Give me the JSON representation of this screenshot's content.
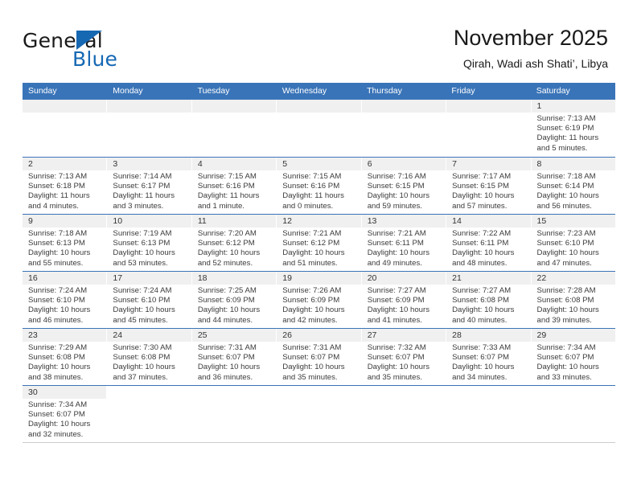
{
  "brand": {
    "name_part1": "General",
    "name_part2": "Blue",
    "logo_icon": "flag-triangle-icon"
  },
  "header": {
    "title": "November 2025",
    "subtitle": "Qirah, Wadi ash Shati’, Libya"
  },
  "calendar": {
    "weekday_headers": [
      "Sunday",
      "Monday",
      "Tuesday",
      "Wednesday",
      "Thursday",
      "Friday",
      "Saturday"
    ],
    "accent_color": "#3a74b8",
    "daynum_strip_color": "#f0f0f0",
    "weeks": [
      [
        {
          "day": "",
          "sunrise": "",
          "sunset": "",
          "daylight_line1": "",
          "daylight_line2": ""
        },
        {
          "day": "",
          "sunrise": "",
          "sunset": "",
          "daylight_line1": "",
          "daylight_line2": ""
        },
        {
          "day": "",
          "sunrise": "",
          "sunset": "",
          "daylight_line1": "",
          "daylight_line2": ""
        },
        {
          "day": "",
          "sunrise": "",
          "sunset": "",
          "daylight_line1": "",
          "daylight_line2": ""
        },
        {
          "day": "",
          "sunrise": "",
          "sunset": "",
          "daylight_line1": "",
          "daylight_line2": ""
        },
        {
          "day": "",
          "sunrise": "",
          "sunset": "",
          "daylight_line1": "",
          "daylight_line2": ""
        },
        {
          "day": "1",
          "sunrise": "Sunrise: 7:13 AM",
          "sunset": "Sunset: 6:19 PM",
          "daylight_line1": "Daylight: 11 hours",
          "daylight_line2": "and 5 minutes."
        }
      ],
      [
        {
          "day": "2",
          "sunrise": "Sunrise: 7:13 AM",
          "sunset": "Sunset: 6:18 PM",
          "daylight_line1": "Daylight: 11 hours",
          "daylight_line2": "and 4 minutes."
        },
        {
          "day": "3",
          "sunrise": "Sunrise: 7:14 AM",
          "sunset": "Sunset: 6:17 PM",
          "daylight_line1": "Daylight: 11 hours",
          "daylight_line2": "and 3 minutes."
        },
        {
          "day": "4",
          "sunrise": "Sunrise: 7:15 AM",
          "sunset": "Sunset: 6:16 PM",
          "daylight_line1": "Daylight: 11 hours",
          "daylight_line2": "and 1 minute."
        },
        {
          "day": "5",
          "sunrise": "Sunrise: 7:15 AM",
          "sunset": "Sunset: 6:16 PM",
          "daylight_line1": "Daylight: 11 hours",
          "daylight_line2": "and 0 minutes."
        },
        {
          "day": "6",
          "sunrise": "Sunrise: 7:16 AM",
          "sunset": "Sunset: 6:15 PM",
          "daylight_line1": "Daylight: 10 hours",
          "daylight_line2": "and 59 minutes."
        },
        {
          "day": "7",
          "sunrise": "Sunrise: 7:17 AM",
          "sunset": "Sunset: 6:15 PM",
          "daylight_line1": "Daylight: 10 hours",
          "daylight_line2": "and 57 minutes."
        },
        {
          "day": "8",
          "sunrise": "Sunrise: 7:18 AM",
          "sunset": "Sunset: 6:14 PM",
          "daylight_line1": "Daylight: 10 hours",
          "daylight_line2": "and 56 minutes."
        }
      ],
      [
        {
          "day": "9",
          "sunrise": "Sunrise: 7:18 AM",
          "sunset": "Sunset: 6:13 PM",
          "daylight_line1": "Daylight: 10 hours",
          "daylight_line2": "and 55 minutes."
        },
        {
          "day": "10",
          "sunrise": "Sunrise: 7:19 AM",
          "sunset": "Sunset: 6:13 PM",
          "daylight_line1": "Daylight: 10 hours",
          "daylight_line2": "and 53 minutes."
        },
        {
          "day": "11",
          "sunrise": "Sunrise: 7:20 AM",
          "sunset": "Sunset: 6:12 PM",
          "daylight_line1": "Daylight: 10 hours",
          "daylight_line2": "and 52 minutes."
        },
        {
          "day": "12",
          "sunrise": "Sunrise: 7:21 AM",
          "sunset": "Sunset: 6:12 PM",
          "daylight_line1": "Daylight: 10 hours",
          "daylight_line2": "and 51 minutes."
        },
        {
          "day": "13",
          "sunrise": "Sunrise: 7:21 AM",
          "sunset": "Sunset: 6:11 PM",
          "daylight_line1": "Daylight: 10 hours",
          "daylight_line2": "and 49 minutes."
        },
        {
          "day": "14",
          "sunrise": "Sunrise: 7:22 AM",
          "sunset": "Sunset: 6:11 PM",
          "daylight_line1": "Daylight: 10 hours",
          "daylight_line2": "and 48 minutes."
        },
        {
          "day": "15",
          "sunrise": "Sunrise: 7:23 AM",
          "sunset": "Sunset: 6:10 PM",
          "daylight_line1": "Daylight: 10 hours",
          "daylight_line2": "and 47 minutes."
        }
      ],
      [
        {
          "day": "16",
          "sunrise": "Sunrise: 7:24 AM",
          "sunset": "Sunset: 6:10 PM",
          "daylight_line1": "Daylight: 10 hours",
          "daylight_line2": "and 46 minutes."
        },
        {
          "day": "17",
          "sunrise": "Sunrise: 7:24 AM",
          "sunset": "Sunset: 6:10 PM",
          "daylight_line1": "Daylight: 10 hours",
          "daylight_line2": "and 45 minutes."
        },
        {
          "day": "18",
          "sunrise": "Sunrise: 7:25 AM",
          "sunset": "Sunset: 6:09 PM",
          "daylight_line1": "Daylight: 10 hours",
          "daylight_line2": "and 44 minutes."
        },
        {
          "day": "19",
          "sunrise": "Sunrise: 7:26 AM",
          "sunset": "Sunset: 6:09 PM",
          "daylight_line1": "Daylight: 10 hours",
          "daylight_line2": "and 42 minutes."
        },
        {
          "day": "20",
          "sunrise": "Sunrise: 7:27 AM",
          "sunset": "Sunset: 6:09 PM",
          "daylight_line1": "Daylight: 10 hours",
          "daylight_line2": "and 41 minutes."
        },
        {
          "day": "21",
          "sunrise": "Sunrise: 7:27 AM",
          "sunset": "Sunset: 6:08 PM",
          "daylight_line1": "Daylight: 10 hours",
          "daylight_line2": "and 40 minutes."
        },
        {
          "day": "22",
          "sunrise": "Sunrise: 7:28 AM",
          "sunset": "Sunset: 6:08 PM",
          "daylight_line1": "Daylight: 10 hours",
          "daylight_line2": "and 39 minutes."
        }
      ],
      [
        {
          "day": "23",
          "sunrise": "Sunrise: 7:29 AM",
          "sunset": "Sunset: 6:08 PM",
          "daylight_line1": "Daylight: 10 hours",
          "daylight_line2": "and 38 minutes."
        },
        {
          "day": "24",
          "sunrise": "Sunrise: 7:30 AM",
          "sunset": "Sunset: 6:08 PM",
          "daylight_line1": "Daylight: 10 hours",
          "daylight_line2": "and 37 minutes."
        },
        {
          "day": "25",
          "sunrise": "Sunrise: 7:31 AM",
          "sunset": "Sunset: 6:07 PM",
          "daylight_line1": "Daylight: 10 hours",
          "daylight_line2": "and 36 minutes."
        },
        {
          "day": "26",
          "sunrise": "Sunrise: 7:31 AM",
          "sunset": "Sunset: 6:07 PM",
          "daylight_line1": "Daylight: 10 hours",
          "daylight_line2": "and 35 minutes."
        },
        {
          "day": "27",
          "sunrise": "Sunrise: 7:32 AM",
          "sunset": "Sunset: 6:07 PM",
          "daylight_line1": "Daylight: 10 hours",
          "daylight_line2": "and 35 minutes."
        },
        {
          "day": "28",
          "sunrise": "Sunrise: 7:33 AM",
          "sunset": "Sunset: 6:07 PM",
          "daylight_line1": "Daylight: 10 hours",
          "daylight_line2": "and 34 minutes."
        },
        {
          "day": "29",
          "sunrise": "Sunrise: 7:34 AM",
          "sunset": "Sunset: 6:07 PM",
          "daylight_line1": "Daylight: 10 hours",
          "daylight_line2": "and 33 minutes."
        }
      ],
      [
        {
          "day": "30",
          "sunrise": "Sunrise: 7:34 AM",
          "sunset": "Sunset: 6:07 PM",
          "daylight_line1": "Daylight: 10 hours",
          "daylight_line2": "and 32 minutes."
        },
        {
          "day": "",
          "sunrise": "",
          "sunset": "",
          "daylight_line1": "",
          "daylight_line2": ""
        },
        {
          "day": "",
          "sunrise": "",
          "sunset": "",
          "daylight_line1": "",
          "daylight_line2": ""
        },
        {
          "day": "",
          "sunrise": "",
          "sunset": "",
          "daylight_line1": "",
          "daylight_line2": ""
        },
        {
          "day": "",
          "sunrise": "",
          "sunset": "",
          "daylight_line1": "",
          "daylight_line2": ""
        },
        {
          "day": "",
          "sunrise": "",
          "sunset": "",
          "daylight_line1": "",
          "daylight_line2": ""
        },
        {
          "day": "",
          "sunrise": "",
          "sunset": "",
          "daylight_line1": "",
          "daylight_line2": ""
        }
      ]
    ]
  }
}
